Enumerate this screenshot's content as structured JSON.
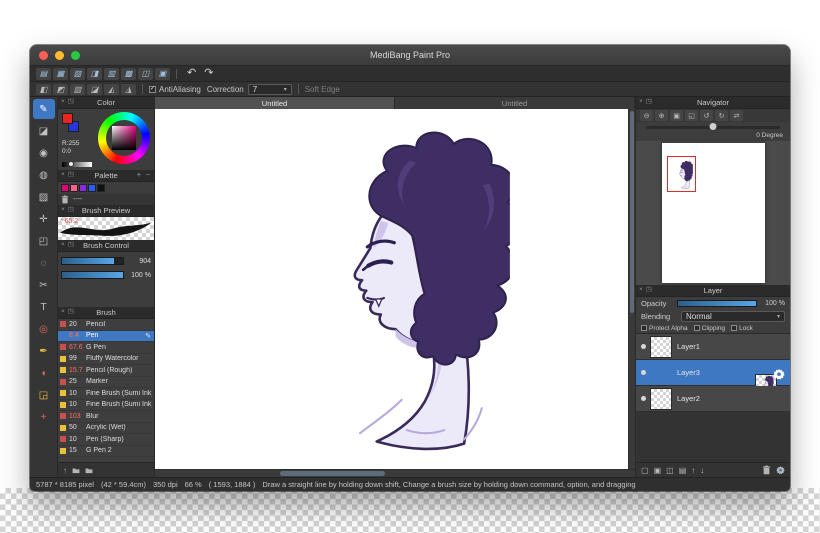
{
  "colors": {
    "accent_blue": "#4a8fd6",
    "selection_blue": "#3f78c2",
    "canvas_white": "#ffffff",
    "hair_purple": "#3f2e63",
    "skin_lavender": "#ece9f8",
    "size_red": "#ff6a5e"
  },
  "icons": {
    "close": "×",
    "popout": "◳",
    "undo": "↶",
    "redo": "↷",
    "dropdown": "▾",
    "check": "✓",
    "plus": "+",
    "minus": "−",
    "up_arrow": "↑",
    "edit": "✎"
  },
  "window": {
    "title": "MediBang Paint Pro"
  },
  "toolbar": {
    "icons": [
      {
        "glyph": "▤"
      },
      {
        "glyph": "▦"
      },
      {
        "glyph": "▧"
      },
      {
        "glyph": "◨"
      },
      {
        "glyph": "▥"
      },
      {
        "glyph": "▩"
      },
      {
        "glyph": "◫"
      },
      {
        "glyph": "▣"
      }
    ],
    "options_icons": [
      {
        "glyph": "◧"
      },
      {
        "glyph": "◩"
      },
      {
        "glyph": "▨"
      },
      {
        "glyph": "◪"
      },
      {
        "glyph": "◭"
      },
      {
        "glyph": "◮"
      }
    ],
    "antialiasing_label": "AntiAliasing",
    "correction_label": "Correction",
    "correction_value": "7",
    "soft_edge_label": "Soft Edge"
  },
  "tools": [
    {
      "glyph": "✎",
      "selected": true
    },
    {
      "glyph": "◪"
    },
    {
      "glyph": "◉"
    },
    {
      "glyph": "◍"
    },
    {
      "glyph": "▨"
    },
    {
      "glyph": "✛"
    },
    {
      "glyph": "◰"
    },
    {
      "glyph": "◌"
    },
    {
      "glyph": "✂"
    },
    {
      "glyph": "T"
    },
    {
      "glyph": "◎",
      "color": "#e06a5a"
    },
    {
      "glyph": "✒",
      "color": "#e8c23a"
    },
    {
      "glyph": "◖",
      "color": "#e06a5a"
    },
    {
      "glyph": "◲",
      "color": "#e8c23a"
    },
    {
      "glyph": "+",
      "color": "#e06a5a"
    }
  ],
  "color_panel": {
    "title": "Color",
    "r_value": "R:255",
    "gb_value": "0:0"
  },
  "palette": {
    "title": "Palette",
    "swatches": [
      "#e6007e",
      "#ff5d8a",
      "#8a2be2",
      "#2b5cff",
      "#111111"
    ],
    "row_label": "----"
  },
  "brush_preview": {
    "title": "Brush Preview",
    "size_label": "* 65.2"
  },
  "brush_control": {
    "title": "Brush Control",
    "sliders": [
      {
        "fill": "85%",
        "value": "904"
      },
      {
        "fill": "100%",
        "value": "100 %"
      }
    ]
  },
  "brush_panel": {
    "title": "Brush",
    "items": [
      {
        "chip": "#c94f4f",
        "size": "20",
        "name": "Pencil"
      },
      {
        "size": "8.4",
        "size_red": true,
        "name": "Pen",
        "selected": true
      },
      {
        "chip": "#c94f4f",
        "size": "67.6",
        "size_red": true,
        "name": "G Pen"
      },
      {
        "chip": "#e8c23a",
        "size": "99",
        "name": "Fluffy Watercolor"
      },
      {
        "chip": "#e8c23a",
        "size": "15.7",
        "size_red": true,
        "name": "Pencil (Rough)"
      },
      {
        "chip": "#c94f4f",
        "size": "25",
        "name": "Marker"
      },
      {
        "chip": "#e8c23a",
        "size": "10",
        "name": "Fine Brush (Sumi Ink)"
      },
      {
        "chip": "#e8c23a",
        "size": "10",
        "name": "Fine Brush (Sumi Ink)"
      },
      {
        "chip": "#c94f4f",
        "size": "103",
        "size_red": true,
        "name": "Blur"
      },
      {
        "chip": "#e8c23a",
        "size": "50",
        "name": "Acrylic (Wet)"
      },
      {
        "chip": "#c94f4f",
        "size": "10",
        "name": "Pen (Sharp)"
      },
      {
        "chip": "#e8c23a",
        "size": "15",
        "name": "G Pen 2"
      }
    ]
  },
  "canvas": {
    "tabs": [
      {
        "label": "Untitled",
        "active": true
      },
      {
        "label": "Untitled"
      }
    ]
  },
  "navigator": {
    "title": "Navigator",
    "degree_label": "0 Degree",
    "tools": [
      {
        "glyph": "⊖"
      },
      {
        "glyph": "⊕"
      },
      {
        "glyph": "▣"
      },
      {
        "glyph": "◱"
      },
      {
        "glyph": "↺"
      },
      {
        "glyph": "↻"
      },
      {
        "glyph": "⇄"
      }
    ]
  },
  "layer_panel": {
    "title": "Layer",
    "opacity_label": "Opacity",
    "opacity_value": "100 %",
    "blending_label": "Blending",
    "blending_value": "Normal",
    "checkboxes": [
      {
        "label": "Protect Alpha"
      },
      {
        "label": "Clipping"
      },
      {
        "label": "Lock"
      }
    ],
    "layers": [
      {
        "name": "Layer1"
      },
      {
        "name": "Layer3",
        "selected": true,
        "art": true
      },
      {
        "name": "Layer2"
      }
    ],
    "bottom_icons": [
      {
        "glyph": "▢"
      },
      {
        "glyph": "▣"
      },
      {
        "glyph": "◫"
      },
      {
        "glyph": "▤"
      },
      {
        "glyph": "↑"
      },
      {
        "glyph": "↓"
      }
    ]
  },
  "statusbar": {
    "size_text": "5787 * 8185 pixel",
    "cm_text": "(42 * 59.4cm)",
    "dpi_text": "350 dpi",
    "zoom_text": "66 %",
    "cursor_text": "( 1593, 1884 )",
    "hint_text": "Draw a straight line by holding down shift, Change a brush size by holding down command, option, and dragging"
  }
}
